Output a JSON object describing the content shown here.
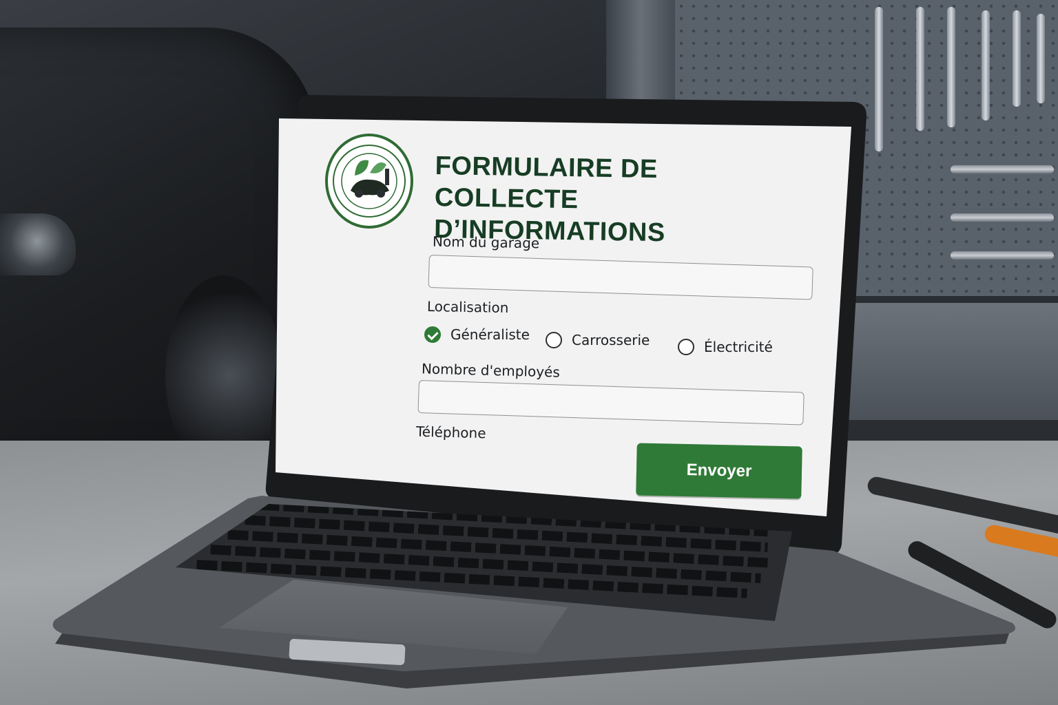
{
  "form": {
    "title_line1": "FORMULAIRE DE COLLECTE",
    "title_line2": "D’INFORMATIONS",
    "fields": {
      "garage_name_label": "Nom du garage",
      "garage_name_value": "",
      "location_label": "Localisation",
      "employees_label": "Nombre d'employés",
      "employees_value": "",
      "phone_label": "Téléphone"
    },
    "location_options": [
      {
        "label": "Généraliste",
        "checked": true
      },
      {
        "label": "Carrosserie",
        "checked": false
      },
      {
        "label": "Électricité",
        "checked": false
      }
    ],
    "submit_label": "Envoyer"
  },
  "colors": {
    "accent": "#2f7a36",
    "title": "#173d24",
    "logo_ring": "#2f6b34"
  },
  "icons": {
    "logo": "garage-leaf-car-logo",
    "radio_checked": "check-icon"
  }
}
